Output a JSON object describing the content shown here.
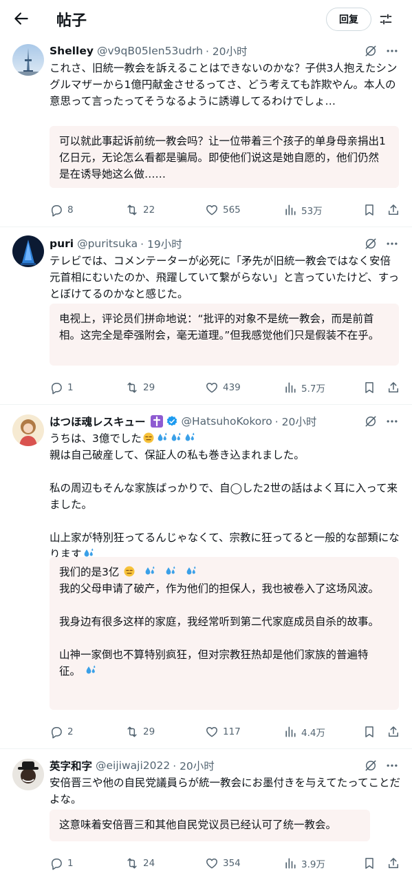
{
  "header": {
    "title": "帖子",
    "reply_label": "回复"
  },
  "posts": [
    {
      "name": "Shelley",
      "handle": "@v9qB05Ien53udrh",
      "time": "· 20小时",
      "text": [
        "これさ、旧統一教会を訴えることはできないのかな？子供3人抱えたシングルマザーから1億円献金させるってさ、どう考えても詐欺やん。本人の意思って言ったってそうなるように誘導してるわけでしょ…"
      ],
      "translation": [
        "可以就此事起诉前统一教会吗？让一位带着三个孩子的单身母亲捐出1亿日元，无论怎么看都是骗局。即使他们说这是她自愿的，他们仍然是在诱导她这么做……"
      ],
      "stats": {
        "replies": "8",
        "reposts": "22",
        "likes": "565",
        "views": "53万"
      }
    },
    {
      "name": "puri",
      "handle": "@puritsuka",
      "time": "· 19小时",
      "text": [
        "テレビでは、コメンテーターが必死に「矛先が旧統一教会ではなく安倍元首相にむいたのか、飛躍していて繋がらない」と言っていたけど、すっとぼけてるのかなと感じた。"
      ],
      "translation": [
        "电视上，评论员们拼命地说：“批评的对象不是统一教会，而是前首相。这完全是牵强附会，毫无道理。”但我感觉他们只是假装不在乎。"
      ],
      "stats": {
        "replies": "1",
        "reposts": "29",
        "likes": "439",
        "views": "5.7万"
      }
    },
    {
      "name": "はつほ魂レスキュー",
      "handle": "@HatsuhoKokoro",
      "time": "· 20小时",
      "text_line1": "うちは、3億でした",
      "text": [
        "親は自己破産して、保証人の私も巻き込まれました。",
        "",
        "私の周辺もそんな家族ばっかりで、自◯した2世の話はよく耳に入って来ました。",
        "",
        "山上家が特別狂ってるんじゃなくて、宗教に狂ってると一般的な部類になります"
      ],
      "translation_line1": "我们的是3亿",
      "translation": [
        "我的父母申请了破产，作为他们的担保人，我也被卷入了这场风波。",
        "",
        "我身边有很多这样的家庭，我经常听到第二代家庭成员自杀的故事。",
        "",
        "山神一家倒也不算特别疯狂，但对宗教狂热却是他们家族的普遍特征。"
      ],
      "stats": {
        "replies": "2",
        "reposts": "29",
        "likes": "117",
        "views": "4.4万"
      }
    },
    {
      "name": "英字和字",
      "handle": "@eijiwaji2022",
      "time": "· 20小时",
      "text": [
        "安倍晋三や他の自民党議員らが統一教会にお墨付きを与えてたってことだよな。"
      ],
      "translation": [
        "这意味着安倍晋三和其他自民党议员已经认可了统一教会。"
      ],
      "stats": {
        "replies": "1",
        "reposts": "24",
        "likes": "354",
        "views": "3.9万"
      }
    }
  ],
  "colors": {
    "text": "#0f1419",
    "muted": "#536471",
    "verified": "#1d9bf0",
    "translation_bg": "#fbf3f2",
    "divider": "#eff3f4",
    "sweat": "#3aa0e8"
  },
  "icons": [
    "back-arrow-icon",
    "filter-icon",
    "grok-icon",
    "more-icon",
    "reply-icon",
    "repost-icon",
    "like-icon",
    "views-icon",
    "bookmark-icon",
    "share-icon",
    "verified-badge-icon",
    "sweat-droplets-icon",
    "expressionless-face-icon",
    "cross-icon"
  ]
}
